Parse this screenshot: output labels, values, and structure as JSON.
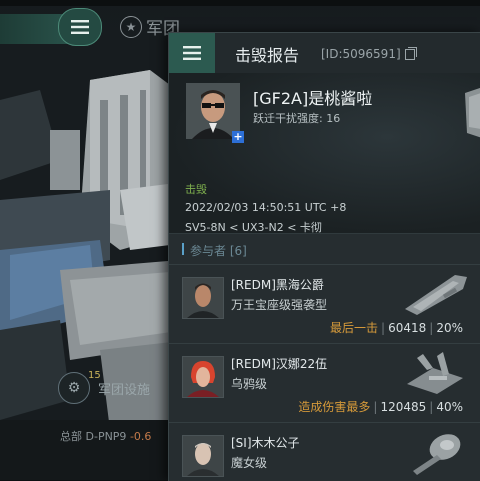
{
  "background": {
    "legion_label": "军团",
    "facility_count": "15",
    "facility_label": "军团设施",
    "hq_label": "总部",
    "hq_system": "D-PNP9",
    "hq_security": "-0.6"
  },
  "report": {
    "title": "击毁报告",
    "id_text": "[ID:5096591]"
  },
  "victim": {
    "name": "[GF2A]是桃酱啦",
    "jump_interference": "跃迁干扰强度: 16",
    "kill_label": "击毁",
    "timestamp": "2022/02/03 14:50:51 UTC +8",
    "location": "SV5-8N < UX3-N2 < 卡彻"
  },
  "participants": {
    "header": "参与者 [6]",
    "rows": [
      {
        "name": "[REDM]黑海公爵",
        "ship": "万王宝座级强袭型",
        "tag": "最后一击",
        "damage": "60418",
        "percent": "20%"
      },
      {
        "name": "[REDM]汉娜22伍",
        "ship": "乌鸦级",
        "tag": "造成伤害最多",
        "damage": "120485",
        "percent": "40%"
      },
      {
        "name": "[SI]木木公子",
        "ship": "魔女级",
        "tag": "",
        "damage": "",
        "percent": ""
      }
    ]
  },
  "colors": {
    "accent_teal": "#2c5a50",
    "tag_orange": "#d69a3a",
    "kill_green": "#7fb04e",
    "section_blue": "#5aa0c8"
  }
}
